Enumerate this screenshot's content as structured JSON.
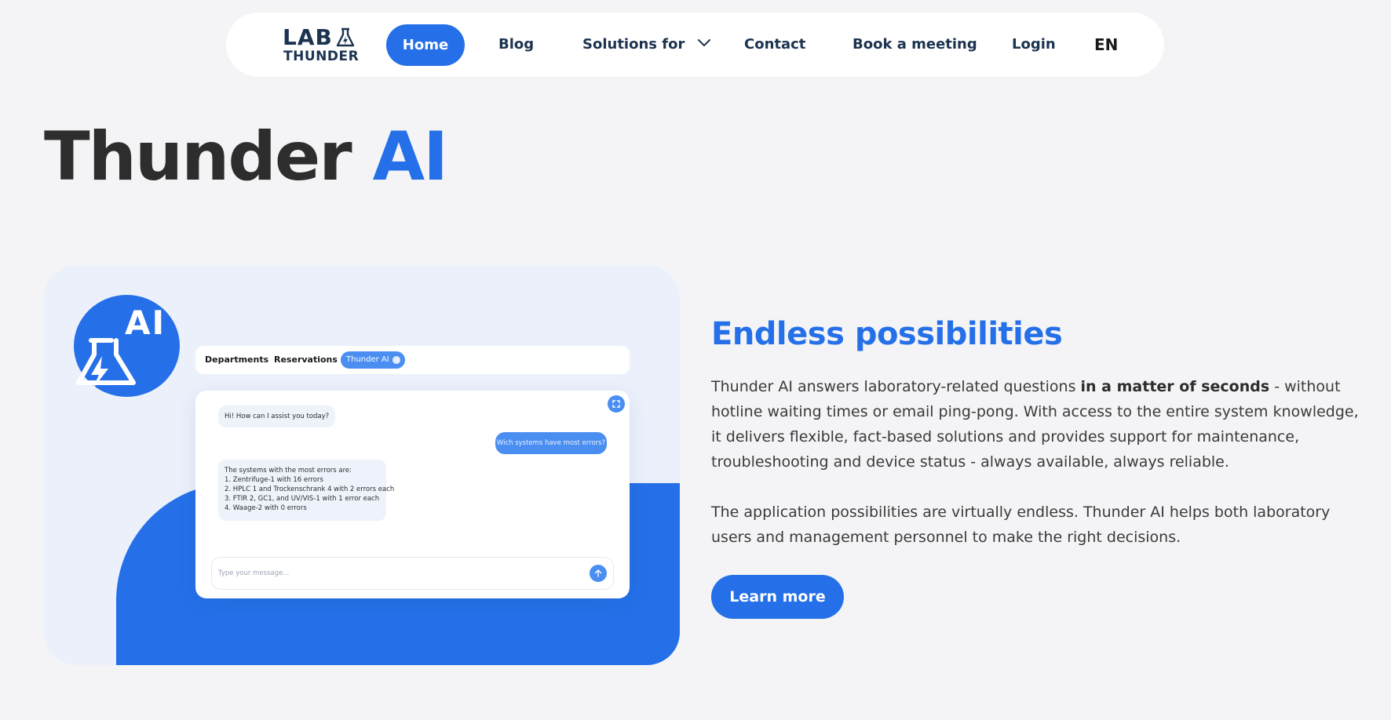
{
  "nav": {
    "logo_top": "LAB",
    "logo_bottom": "THUNDER",
    "items": [
      {
        "label": "Home"
      },
      {
        "label": "Blog"
      },
      {
        "label": "Solutions for"
      },
      {
        "label": "Contact"
      },
      {
        "label": "Book a meeting"
      },
      {
        "label": "Login"
      },
      {
        "label": "EN"
      }
    ]
  },
  "hero": {
    "title_main": "Thunder",
    "title_accent": "AI"
  },
  "illustration": {
    "badge_label": "AI",
    "tabs": [
      "Departments",
      "Reservations",
      "Thunder AI"
    ],
    "chat": {
      "greeting": "Hi! How can I assist you today?",
      "user_question": "Wich systems have most errors?",
      "answer_lines": [
        "The systems with the most errors are:",
        "1. Zentrifuge-1 with 16 errors",
        "2. HPLC 1 and Trockenschrank 4 with 2 errors each",
        "3. FTIR 2, GC1, and UV/VIS-1 with 1 error each",
        "4. Waage-2 with 0 errors"
      ],
      "input_placeholder": "Type your message..."
    }
  },
  "section": {
    "title": "Endless possibilities",
    "p1_before": "Thunder AI answers laboratory-related questions ",
    "p1_bold": "in a matter of seconds",
    "p1_after": " - without hotline waiting times or email ping-pong. With access to the entire system knowledge, it delivers flexible, fact-based solutions and provides support for maintenance, troubleshooting and device status - always available, always reliable.",
    "p2": "The application possibilities are virtually endless. Thunder AI helps both laboratory users and management personnel to make the right decisions.",
    "cta": "Learn more"
  },
  "colors": {
    "brand_blue": "#2570e8",
    "navy": "#1c3350",
    "background": "#f4f4f6"
  }
}
